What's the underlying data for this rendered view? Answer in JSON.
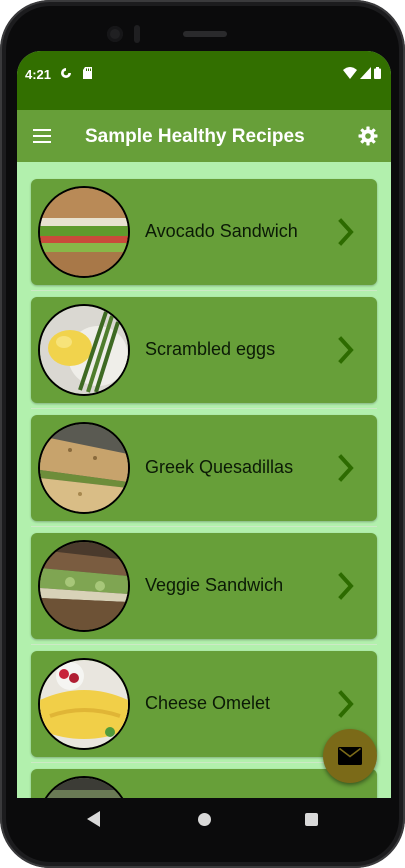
{
  "status_bar": {
    "time": "4:21",
    "left_icons": [
      "sync-icon",
      "sd-card-icon"
    ],
    "right_icons": [
      "wifi-icon",
      "signal-icon",
      "battery-icon"
    ],
    "background": "#326f00"
  },
  "app_bar": {
    "title": "Sample Healthy Recipes",
    "menu_icon": "hamburger-menu-icon",
    "settings_icon": "gear-icon",
    "background": "#679f39"
  },
  "recipes": [
    {
      "name": "Avocado Sandwich",
      "image": "avocado-sandwich-photo"
    },
    {
      "name": "Scrambled eggs",
      "image": "scrambled-eggs-photo"
    },
    {
      "name": "Greek Quesadillas",
      "image": "greek-quesadillas-photo"
    },
    {
      "name": "Veggie Sandwich",
      "image": "veggie-sandwich-photo"
    },
    {
      "name": "Cheese Omelet",
      "image": "cheese-omelet-photo"
    }
  ],
  "fab": {
    "icon": "mail-icon",
    "color": "#7b6a18"
  },
  "colors": {
    "list_background": "#b2f0ad",
    "card": "#679f39",
    "chevron": "#2d6b00"
  },
  "nav_bar": {
    "buttons": [
      "back-icon",
      "home-icon",
      "recents-icon"
    ]
  }
}
